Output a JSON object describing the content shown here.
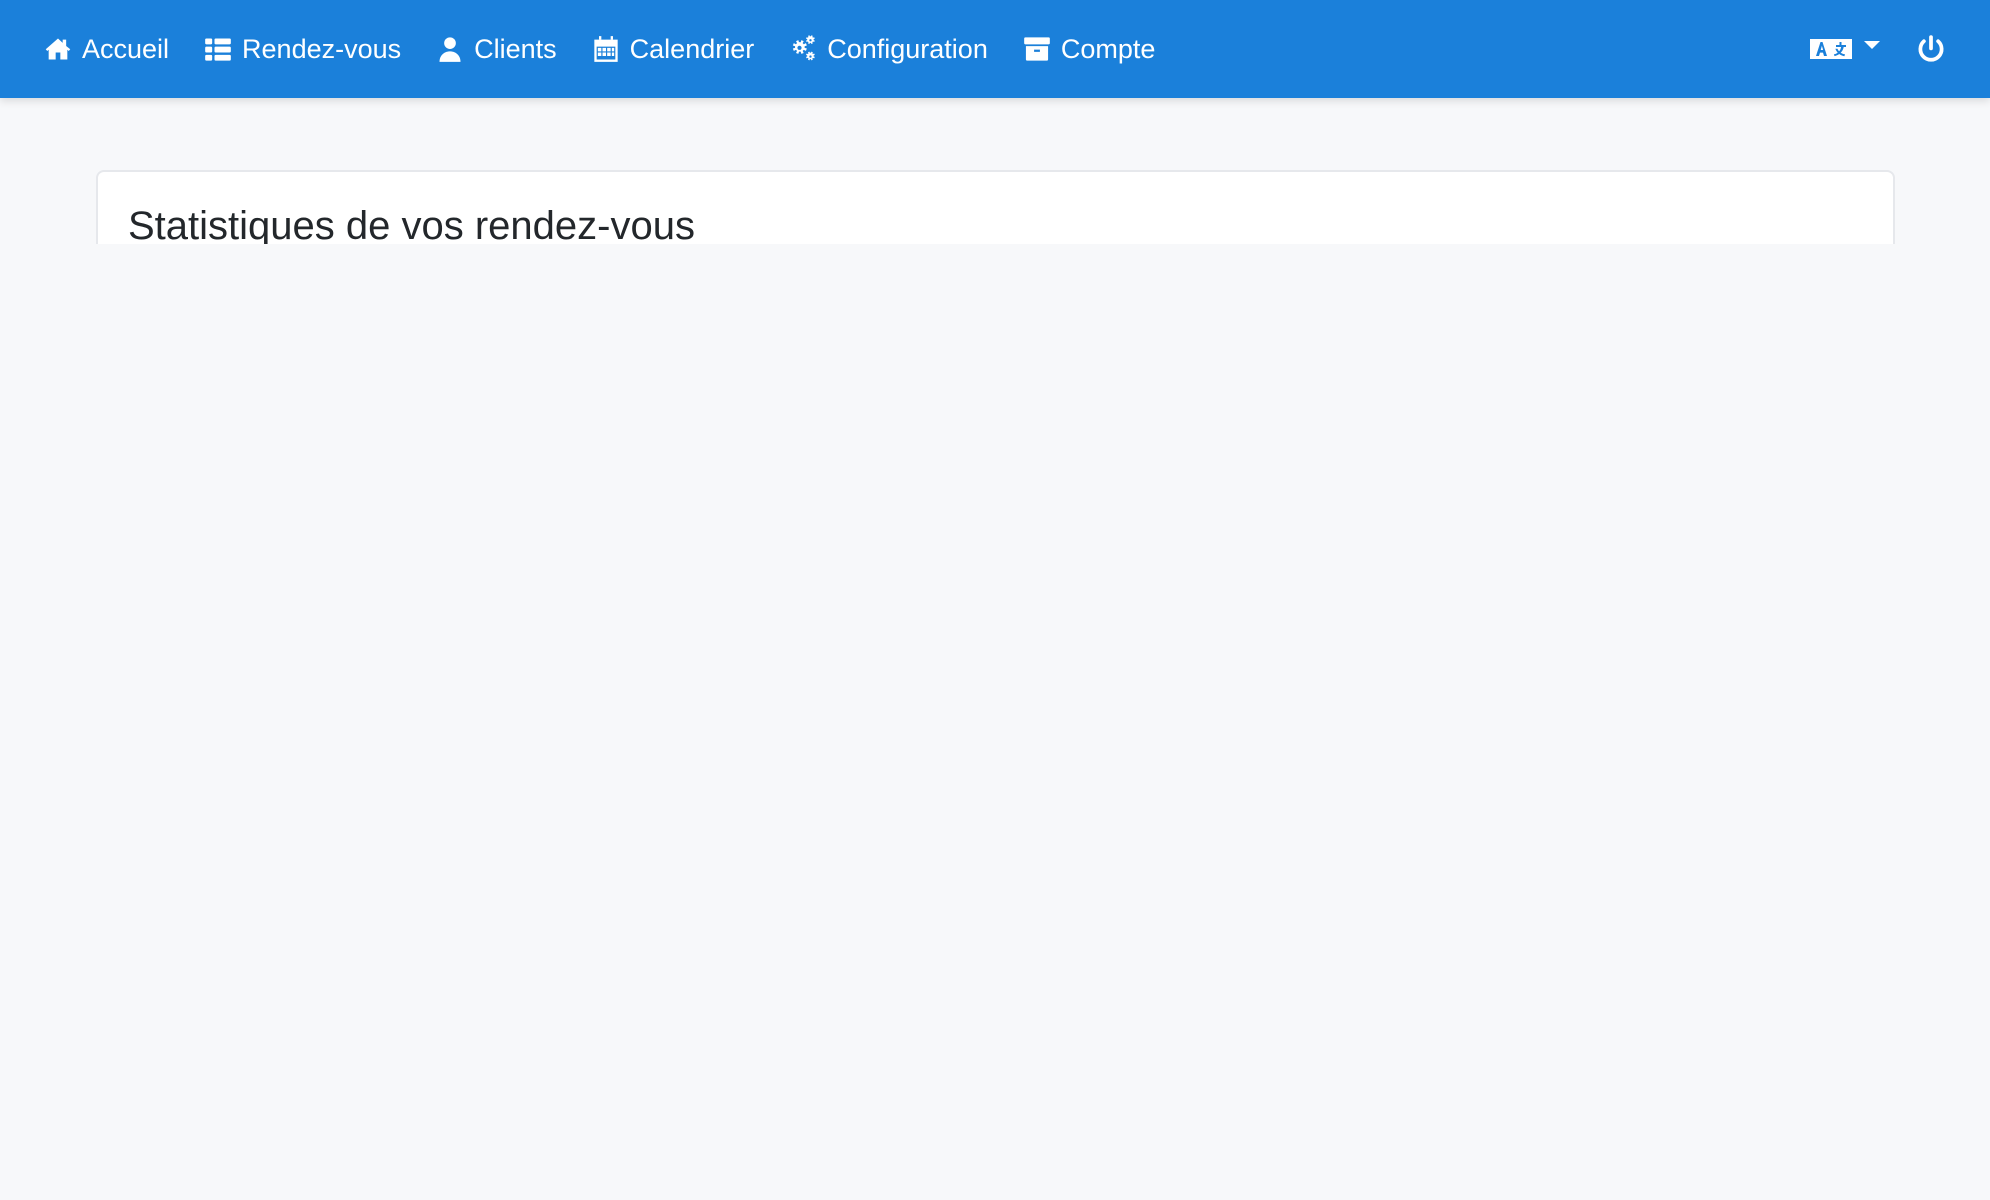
{
  "navbar": {
    "background": "#1b80da",
    "items": [
      {
        "label": "Accueil",
        "icon": "home-icon"
      },
      {
        "label": "Rendez-vous",
        "icon": "list-icon"
      },
      {
        "label": "Clients",
        "icon": "user-icon"
      },
      {
        "label": "Calendrier",
        "icon": "calendar-icon"
      },
      {
        "label": "Configuration",
        "icon": "cogs-icon"
      },
      {
        "label": "Compte",
        "icon": "archive-icon"
      }
    ],
    "language_icon": "translate-icon",
    "logout_icon": "power-icon"
  },
  "main": {
    "card_title": "Statistiques de vos rendez-vous"
  }
}
